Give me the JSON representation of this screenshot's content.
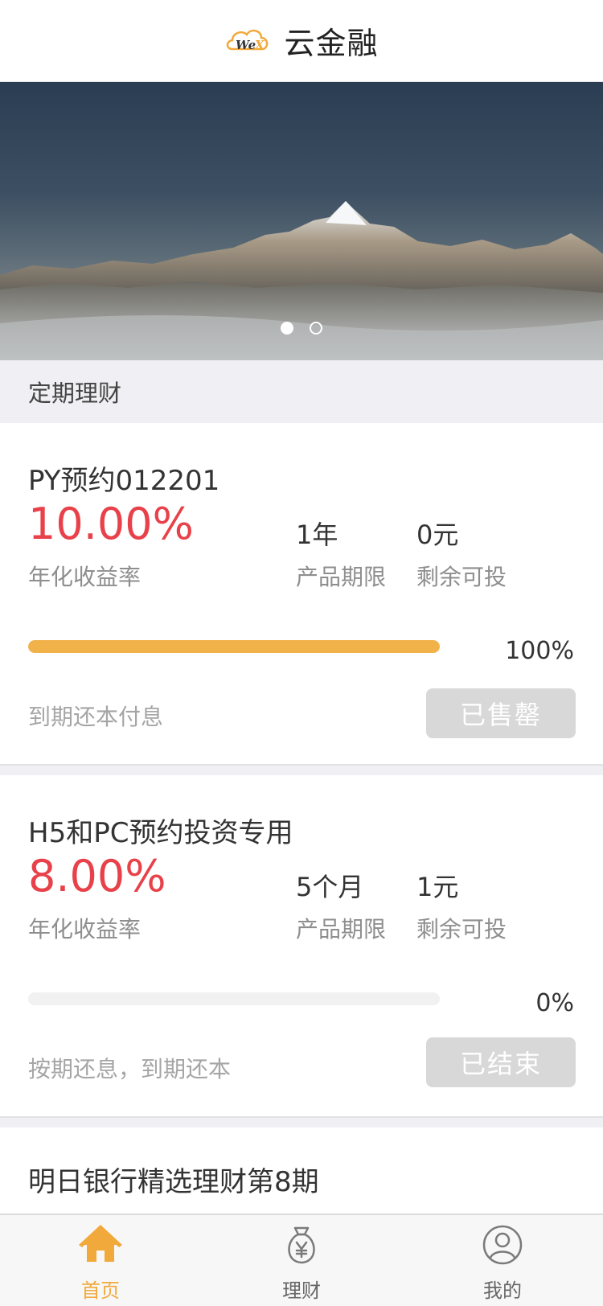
{
  "header": {
    "title": "云金融",
    "logo_text": "WeX"
  },
  "banner": {
    "slides": 2,
    "active_slide": 1
  },
  "section": {
    "title": "定期理财"
  },
  "products": [
    {
      "name": "PY预约012201",
      "rate": "10.00%",
      "rate_label": "年化收益率",
      "term": "1年",
      "term_label": "产品期限",
      "remaining": "0元",
      "remaining_label": "剩余可投",
      "progress": 100,
      "progress_text": "100%",
      "repayment": "到期还本付息",
      "status": "已售罄"
    },
    {
      "name": "H5和PC预约投资专用",
      "rate": "8.00%",
      "rate_label": "年化收益率",
      "term": "5个月",
      "term_label": "产品期限",
      "remaining": "1元",
      "remaining_label": "剩余可投",
      "progress": 0,
      "progress_text": "0%",
      "repayment": "按期还息，到期还本",
      "status": "已结束"
    },
    {
      "name": "明日银行精选理财第8期"
    }
  ],
  "tabbar": {
    "items": [
      {
        "label": "首页",
        "icon": "home-icon",
        "active": true
      },
      {
        "label": "理财",
        "icon": "money-bag-icon",
        "active": false
      },
      {
        "label": "我的",
        "icon": "user-icon",
        "active": false
      }
    ],
    "active_color": "#f2a93b"
  },
  "colors": {
    "accent": "#e8414a",
    "progress": "#f2b24a",
    "disabled": "#d8d8d8"
  }
}
